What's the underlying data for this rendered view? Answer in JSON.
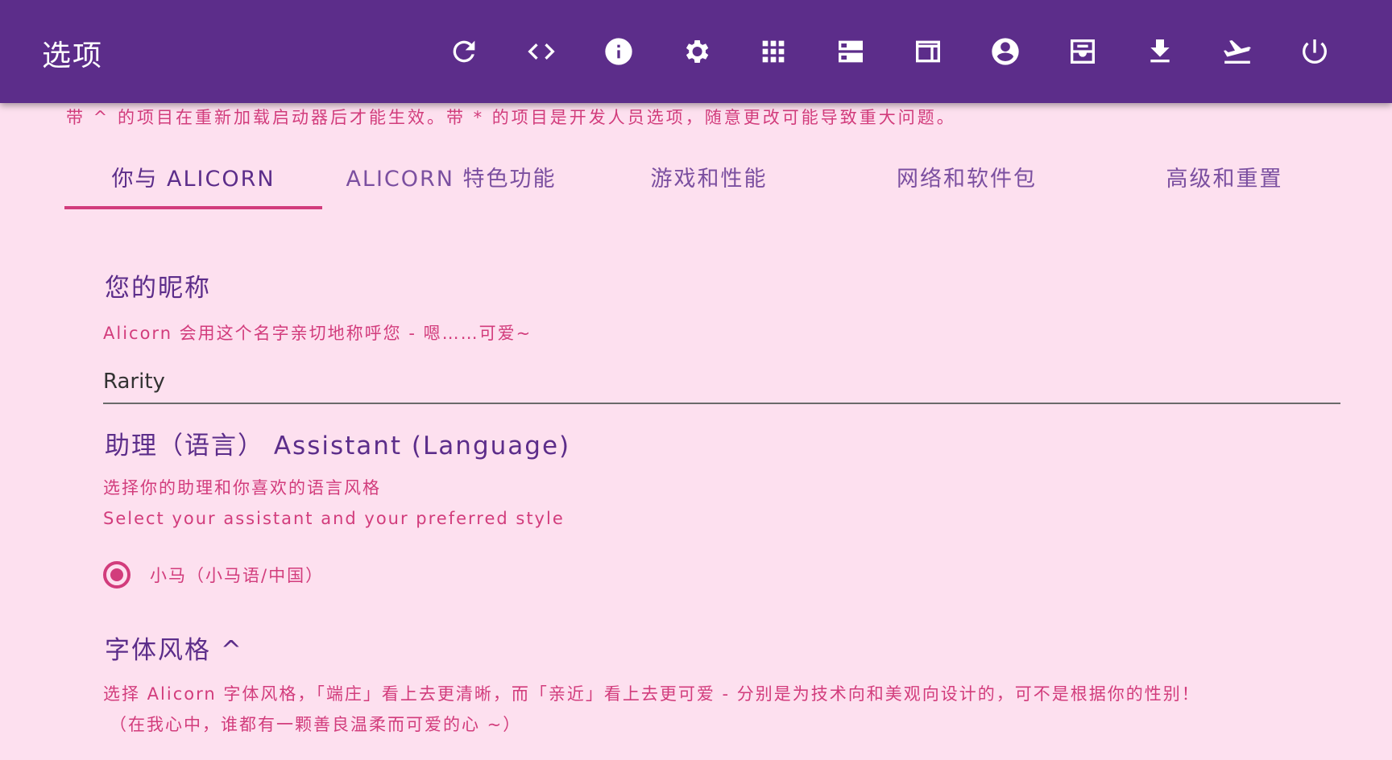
{
  "appbar": {
    "title": "选项",
    "icons": [
      "refresh-icon",
      "code-icon",
      "info-icon",
      "settings-icon",
      "apps-grid-icon",
      "storage-icon",
      "web-layout-icon",
      "account-icon",
      "inbox-icon",
      "download-icon",
      "flight-takeoff-icon",
      "power-icon"
    ]
  },
  "notice": "带 ^ 的项目在重新加载启动器后才能生效。带 * 的项目是开发人员选项，随意更改可能导致重大问题。",
  "tabs": [
    {
      "label": "你与 ALICORN",
      "active": true
    },
    {
      "label": "ALICORN 特色功能",
      "active": false
    },
    {
      "label": "游戏和性能",
      "active": false
    },
    {
      "label": "网络和软件包",
      "active": false
    },
    {
      "label": "高级和重置",
      "active": false
    }
  ],
  "nickname": {
    "title": "您的昵称",
    "description": "Alicorn 会用这个名字亲切地称呼您 - 嗯……可爱~",
    "value": "Rarity"
  },
  "assistant": {
    "title": "助理（语言） Assistant (Language)",
    "description_cn": "选择你的助理和你喜欢的语言风格",
    "description_en": "Select your assistant and your preferred style",
    "options": [
      {
        "label": "小马（小马语/中国）",
        "selected": true
      }
    ]
  },
  "font_style": {
    "title": "字体风格 ^",
    "description_line1": "选择 Alicorn 字体风格，「端庄」看上去更清晰，而「亲近」看上去更可爱 - 分别是为技术向和美观向设计的，可不是根据你的性别！",
    "description_line2": "（在我心中，谁都有一颗善良温柔而可爱的心 ~）"
  },
  "colors": {
    "appbar": "#5c2d8a",
    "background": "#fde0ef",
    "accent": "#d23c7c",
    "heading": "#5c2d8a"
  }
}
